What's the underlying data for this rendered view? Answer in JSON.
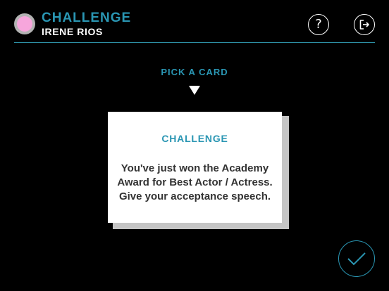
{
  "header": {
    "mode_title": "CHALLENGE",
    "player_name": "IRENE RIOS",
    "avatar_color": "#f7a6dc",
    "help_icon": "question-icon",
    "exit_icon": "exit-icon"
  },
  "prompt": {
    "pick_label": "PICK A CARD"
  },
  "card": {
    "title": "CHALLENGE",
    "text": "You've just won the Academy Award for Best Actor / Actress. Give your acceptance speech."
  },
  "confirm": {
    "icon": "checkmark-icon"
  },
  "colors": {
    "accent": "#2a96b3",
    "background": "#000000",
    "card": "#ffffff"
  }
}
